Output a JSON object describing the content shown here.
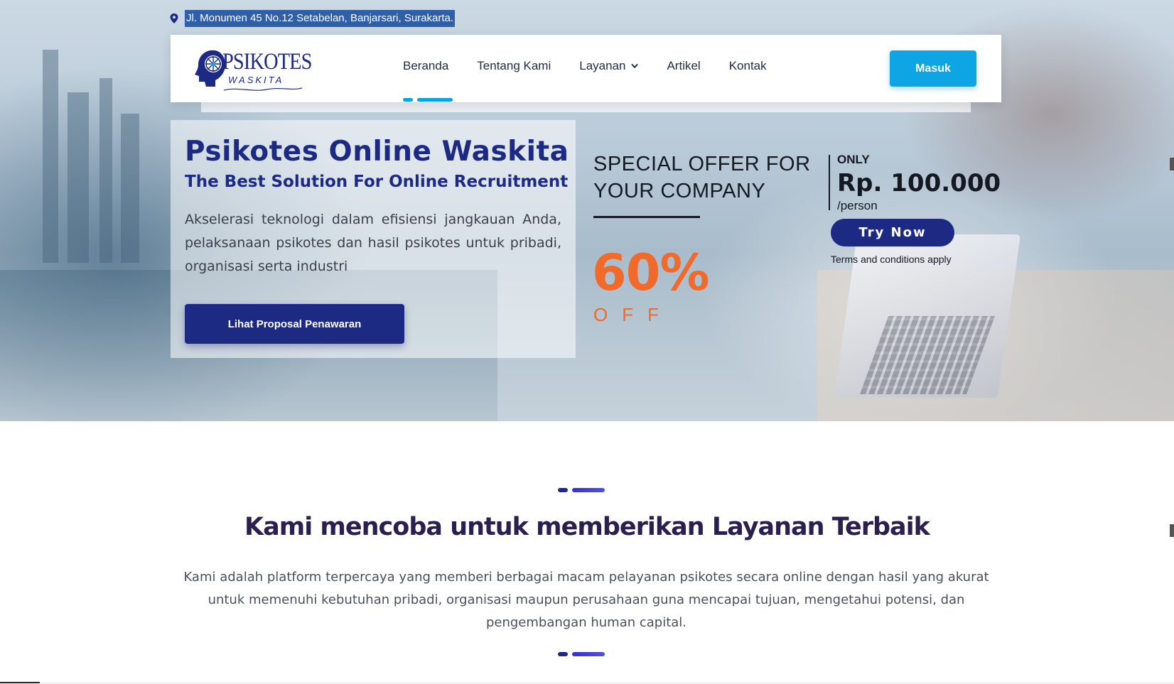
{
  "topbar": {
    "address": "Jl. Monumen 45 No.12 Setabelan, Banjarsari, Surakarta."
  },
  "logo": {
    "title": "PSIKOTES",
    "subtitle": "WASKITA"
  },
  "nav": {
    "items": [
      {
        "label": "Beranda",
        "active": true
      },
      {
        "label": "Tentang Kami",
        "active": false
      },
      {
        "label": "Layanan",
        "active": false,
        "has_dropdown": true
      },
      {
        "label": "Artikel",
        "active": false
      },
      {
        "label": "Kontak",
        "active": false
      }
    ],
    "login_label": "Masuk"
  },
  "hero": {
    "title": "Psikotes Online Waskita",
    "subtitle": "The Best Solution For Online Recruitment",
    "description": "Akselerasi teknologi dalam efisiensi jangkauan Anda, pelaksanaan psikotes dan hasil psikotes untuk pribadi, organisasi serta industri",
    "cta_label": "Lihat Proposal Penawaran"
  },
  "promo": {
    "headline": "SPECIAL OFFER FOR YOUR COMPANY",
    "discount": "60%",
    "discount_suffix": "OFF",
    "only_label": "ONLY",
    "price": "Rp. 100.000",
    "price_unit": "/person",
    "try_label": "Try Now",
    "terms": "Terms and conditions apply"
  },
  "services": {
    "title": "Kami mencoba untuk memberikan Layanan Terbaik",
    "description": "Kami adalah platform terpercaya yang memberi berbagai macam pelayanan psikotes secara online dengan hasil yang akurat untuk memenuhi kebutuhan pribadi, organisasi maupun perusahaan guna mencapai tujuan, mengetahui potensi, dan pengembangan human capital."
  },
  "colors": {
    "brand_navy": "#1d2a83",
    "accent_blue": "#0ea5e4",
    "promo_orange": "#ef6a2b",
    "heading_dark": "#2a1f4f"
  },
  "icons": {
    "address": "map-pin-icon",
    "dropdown": "chevron-down-icon",
    "logo": "head-compass-logo-icon"
  }
}
